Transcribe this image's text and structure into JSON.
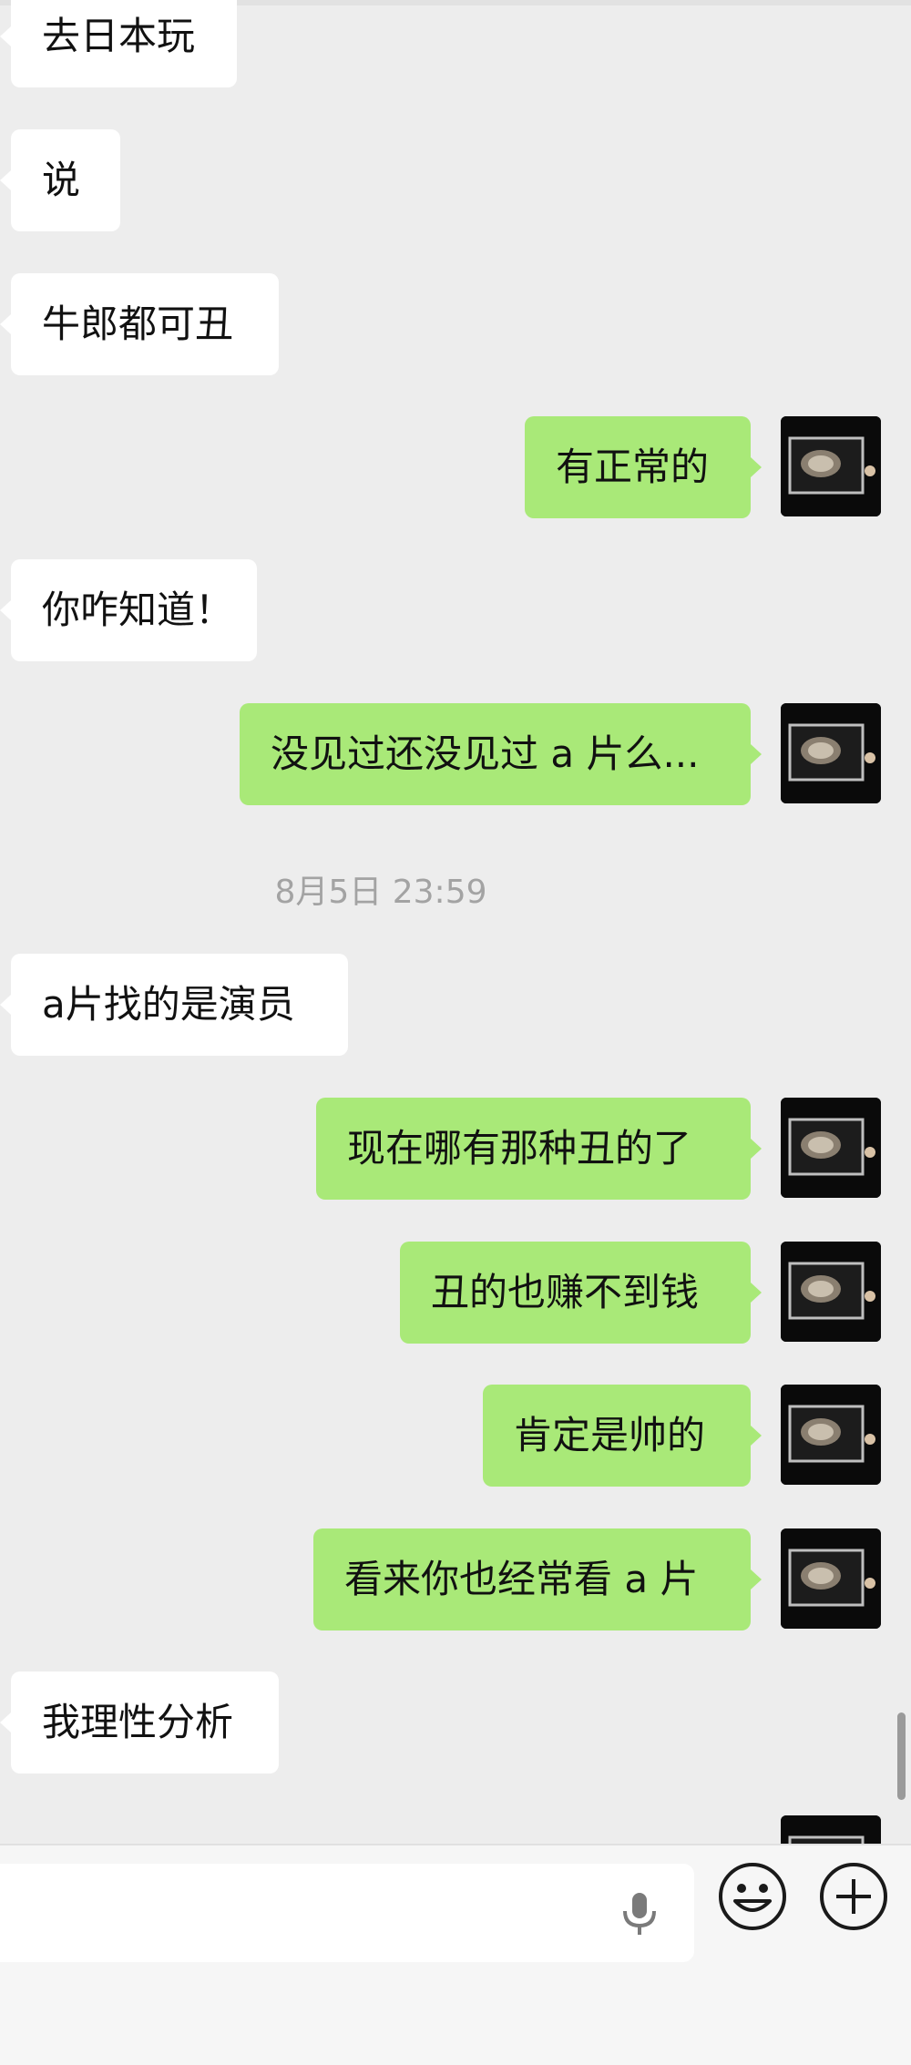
{
  "messages": [
    {
      "side": "in",
      "text": "去日本玩"
    },
    {
      "side": "in",
      "text": "说"
    },
    {
      "side": "in",
      "text": "牛郎都可丑"
    },
    {
      "side": "out",
      "text": "有正常的"
    },
    {
      "side": "in",
      "text": "你咋知道！"
    },
    {
      "side": "out",
      "text": "没见过还没见过 a 片么..."
    },
    {
      "side": "in",
      "text": "a片找的是演员"
    },
    {
      "side": "out",
      "text": "现在哪有那种丑的了"
    },
    {
      "side": "out",
      "text": "丑的也赚不到钱"
    },
    {
      "side": "out",
      "text": "肯定是帅的"
    },
    {
      "side": "out",
      "text": "看来你也经常看 a 片"
    },
    {
      "side": "in",
      "text": "我理性分析"
    }
  ],
  "timestamp": "8月5日 23:59",
  "colors": {
    "background": "#ededed",
    "incoming_bubble": "#ffffff",
    "outgoing_bubble": "#a9e978"
  },
  "icons": {
    "mic": "microphone-icon",
    "emoji": "smiley-face-icon",
    "plus": "plus-circle-icon"
  }
}
